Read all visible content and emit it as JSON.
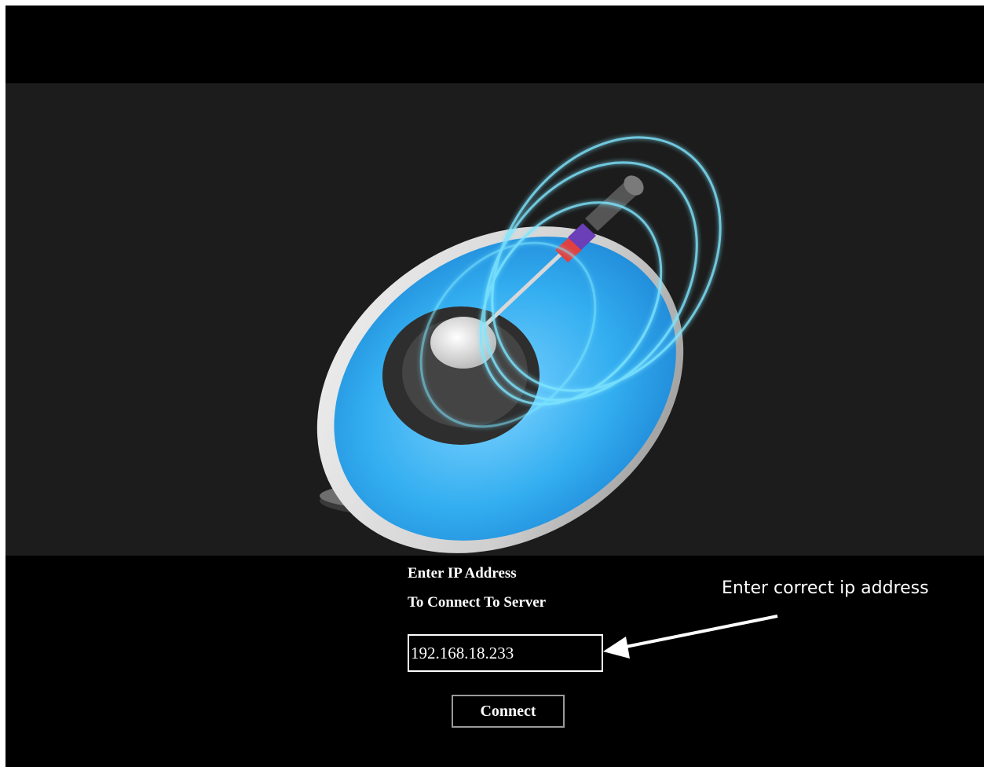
{
  "form": {
    "title_line1": "Enter IP Address",
    "title_line2": "To Connect To Server",
    "ip_value": "192.168.18.233",
    "connect_label": "Connect"
  },
  "annotation": {
    "text": "Enter correct ip address"
  },
  "hero": {
    "icon": "satellite-dish-icon"
  },
  "colors": {
    "page_background": "#000000",
    "hero_background": "#1c1c1c",
    "dish_blue": "#2fa9ee",
    "text": "#ffffff"
  }
}
